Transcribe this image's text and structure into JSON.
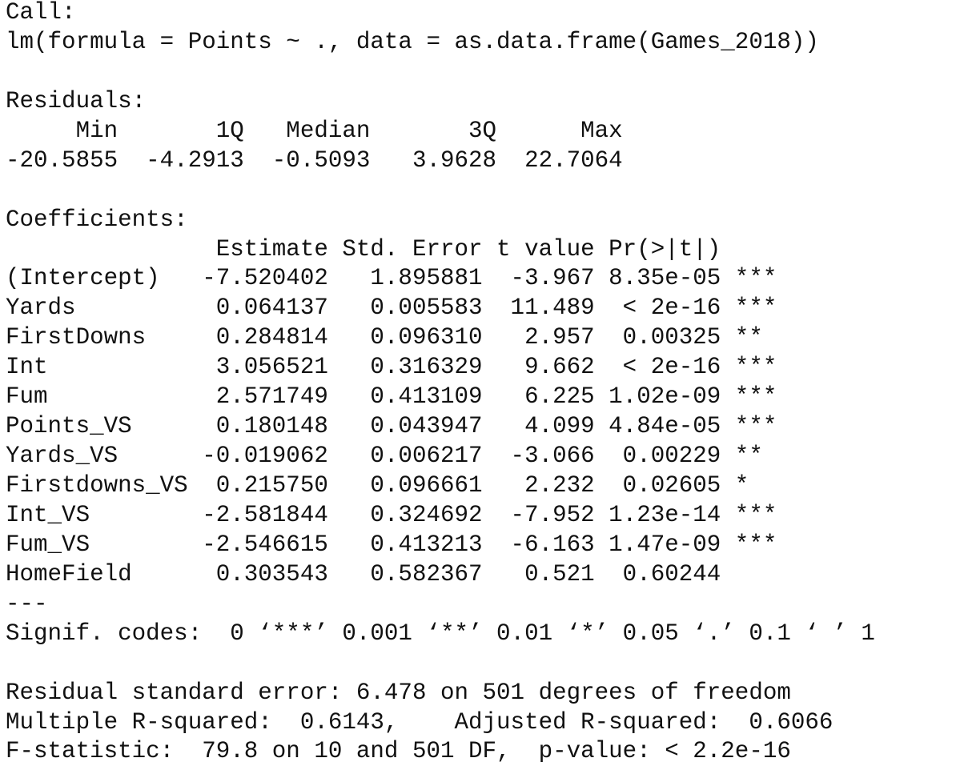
{
  "call": {
    "label": "Call:",
    "formula": "lm(formula = Points ~ ., data = as.data.frame(Games_2018))"
  },
  "residuals": {
    "label": "Residuals:",
    "header": "     Min       1Q   Median       3Q      Max ",
    "values": "-20.5855  -4.2913  -0.5093   3.9628  22.7064 "
  },
  "coefficients": {
    "label": "Coefficients:",
    "header": "               Estimate Std. Error t value Pr(>|t|)    ",
    "rows": [
      "(Intercept)   -7.520402   1.895881  -3.967 8.35e-05 ***",
      "Yards          0.064137   0.005583  11.489  < 2e-16 ***",
      "FirstDowns     0.284814   0.096310   2.957  0.00325 ** ",
      "Int            3.056521   0.316329   9.662  < 2e-16 ***",
      "Fum            2.571749   0.413109   6.225 1.02e-09 ***",
      "Points_VS      0.180148   0.043947   4.099 4.84e-05 ***",
      "Yards_VS      -0.019062   0.006217  -3.066  0.00229 ** ",
      "Firstdowns_VS  0.215750   0.096661   2.232  0.02605 *  ",
      "Int_VS        -2.581844   0.324692  -7.952 1.23e-14 ***",
      "Fum_VS        -2.546615   0.413213  -6.163 1.47e-09 ***",
      "HomeField      0.303543   0.582367   0.521  0.60244    "
    ],
    "separator": "---",
    "signif_codes": "Signif. codes:  0 ‘***’ 0.001 ‘**’ 0.01 ‘*’ 0.05 ‘.’ 0.1 ‘ ’ 1"
  },
  "summary": {
    "residual_se": "Residual standard error: 6.478 on 501 degrees of freedom",
    "r_squared": "Multiple R-squared:  0.6143,\tAdjusted R-squared:  0.6066 ",
    "f_statistic": "F-statistic:  79.8 on 10 and 501 DF,  p-value: < 2.2e-16"
  }
}
